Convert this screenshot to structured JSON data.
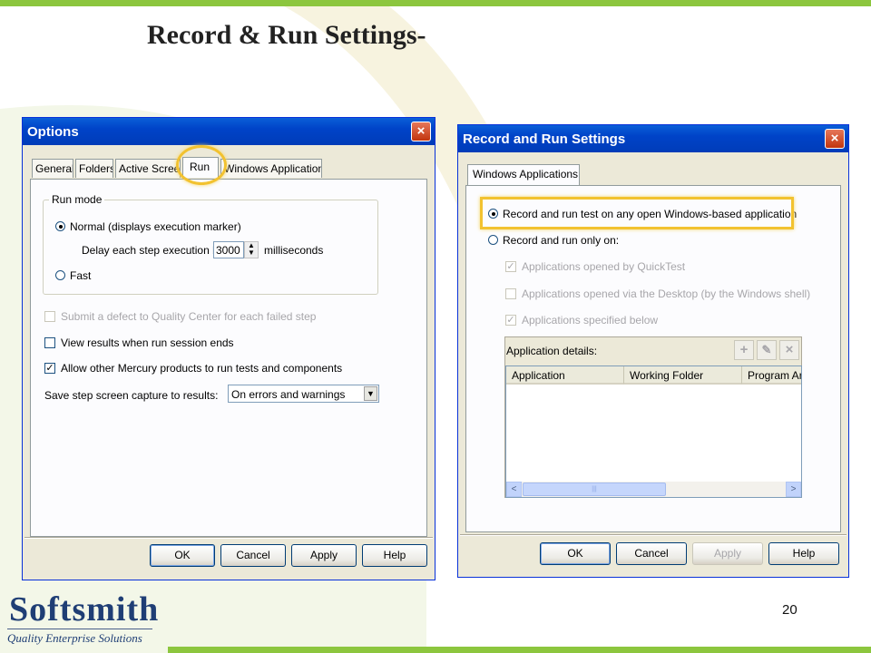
{
  "slide": {
    "title": "Record & Run Settings-",
    "page_number": "20",
    "logo": {
      "name": "Softsmith",
      "tagline": "Quality Enterprise Solutions"
    },
    "accent_color": "#8cc63e",
    "highlight_color": "#f2c230"
  },
  "options_dialog": {
    "title": "Options",
    "close_icon": "×",
    "tabs": [
      "General",
      "Folders",
      "Active Screen",
      "Run",
      "Windows Applications"
    ],
    "active_tab": "Run",
    "run_mode": {
      "label": "Run mode",
      "normal": "Normal (displays execution marker)",
      "delay_label": "Delay each step execution by:",
      "delay_value": "3000",
      "delay_unit": "milliseconds",
      "fast": "Fast"
    },
    "checkboxes": {
      "submit_defect": "Submit a defect to Quality Center for each failed step",
      "view_results": "View results when run session ends",
      "allow_mercury": "Allow other Mercury products to run tests and components"
    },
    "capture": {
      "label": "Save step screen capture to results:",
      "value": "On errors and warnings"
    },
    "buttons": {
      "ok": "OK",
      "cancel": "Cancel",
      "apply": "Apply",
      "help": "Help"
    }
  },
  "record_dialog": {
    "title": "Record and Run Settings",
    "close_icon": "×",
    "tab": "Windows Applications",
    "options": {
      "any_app": "Record and run test on any open Windows-based application",
      "only_on": "Record and run only on:"
    },
    "checkboxes": {
      "quicktest": "Applications opened by QuickTest",
      "desktop": "Applications opened via the Desktop (by the Windows shell)",
      "specified": "Applications specified below"
    },
    "app_details": {
      "label": "Application details:",
      "tools": {
        "add": "+",
        "edit": "✎",
        "delete": "×"
      },
      "columns": [
        "Application",
        "Working Folder",
        "Program Arg"
      ]
    },
    "scrollbar": {
      "left": "<",
      "right": ">",
      "grip": "|||"
    },
    "buttons": {
      "ok": "OK",
      "cancel": "Cancel",
      "apply": "Apply",
      "help": "Help"
    }
  }
}
